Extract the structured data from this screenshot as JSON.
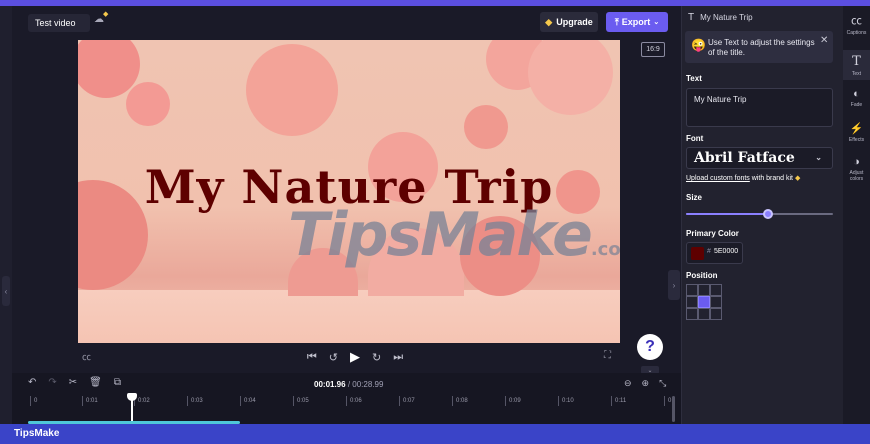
{
  "topbar": {
    "project_title": "Test video",
    "upgrade_label": "Upgrade",
    "export_label": "Export"
  },
  "preview": {
    "overlay_title": "My Nature Trip",
    "watermark_main": "TipsMake",
    "watermark_suffix": ".com",
    "aspect_ratio": "16:9"
  },
  "timeline": {
    "current_time": "00:01.96",
    "total_time": "/ 00:28.99",
    "ticks": [
      "0",
      "0:01",
      "0:02",
      "0:03",
      "0:04",
      "0:05",
      "0:06",
      "0:07",
      "0:08",
      "0:09",
      "0:10",
      "0:11",
      "0"
    ]
  },
  "right_panel": {
    "header_title": "My Nature Trip",
    "tip_text": "Use Text to adjust the settings of the title.",
    "text_label": "Text",
    "text_value": "My Nature Trip",
    "font_label": "Font",
    "font_value": "Abril Fatface",
    "brand_link_text": "Upload custom fonts",
    "brand_link_suffix": "with brand kit",
    "size_label": "Size",
    "size_fraction": 0.56,
    "primary_color_label": "Primary Color",
    "primary_color_hash": "#",
    "primary_color_hex": "5E0000",
    "primary_color_swatch": "#5E0000",
    "position_label": "Position",
    "position_selected": "center"
  },
  "tools": {
    "captions": "Captions",
    "text": "Text",
    "fade": "Fade",
    "effects": "Effects",
    "adjust": "Adjust colors"
  },
  "footer": {
    "brand": "TipsMake"
  },
  "colors": {
    "accent": "#6b5cf0",
    "title_color": "#5e0000",
    "footer": "#3a44c8"
  }
}
